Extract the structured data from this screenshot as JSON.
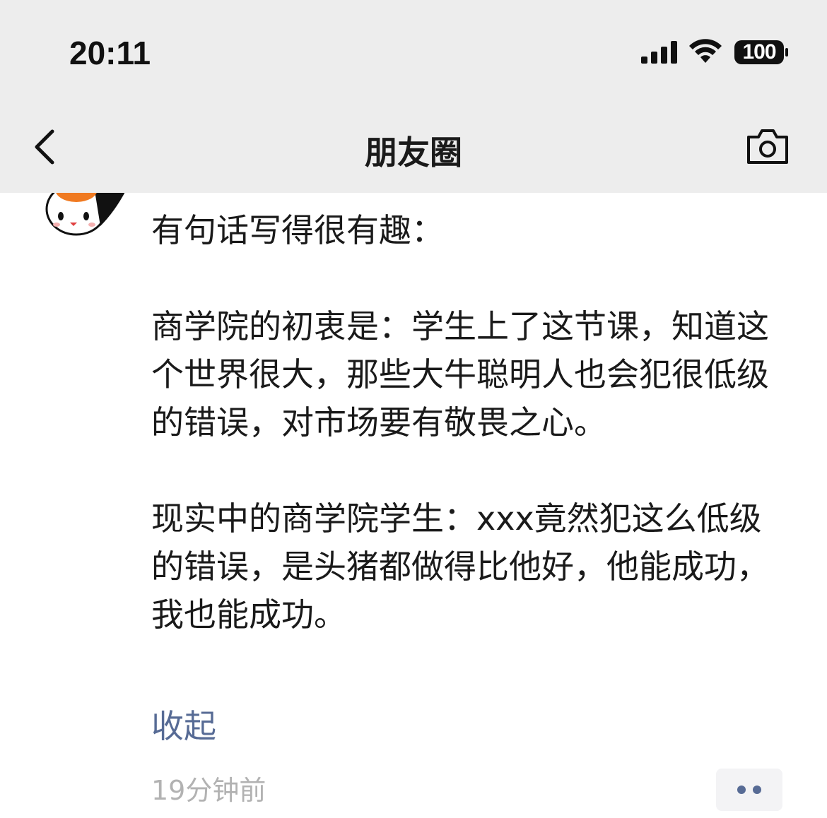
{
  "status_bar": {
    "time": "20:11",
    "battery": "100",
    "icons": [
      "signal-icon",
      "wifi-icon",
      "battery-icon"
    ]
  },
  "nav": {
    "title": "朋友圈",
    "back_icon": "chevron-left-icon",
    "camera_icon": "camera-icon"
  },
  "post": {
    "paragraphs": [
      "有句话写得很有趣：",
      "商学院的初衷是：学生上了这节课，知道这个世界很大，那些大牛聪明人也会犯很低级的错误，对市场要有敬畏之心。",
      "现实中的商学院学生：xxx竟然犯这么低级的错误，是头猪都做得比他好，他能成功，我也能成功。"
    ],
    "collapse_label": "收起",
    "timestamp": "19分钟前",
    "more_icon": "more-dots-icon"
  },
  "colors": {
    "topbar_bg": "#ededed",
    "link": "#576b95",
    "timestamp": "#b2b2b2",
    "text": "#1a1a1a"
  }
}
